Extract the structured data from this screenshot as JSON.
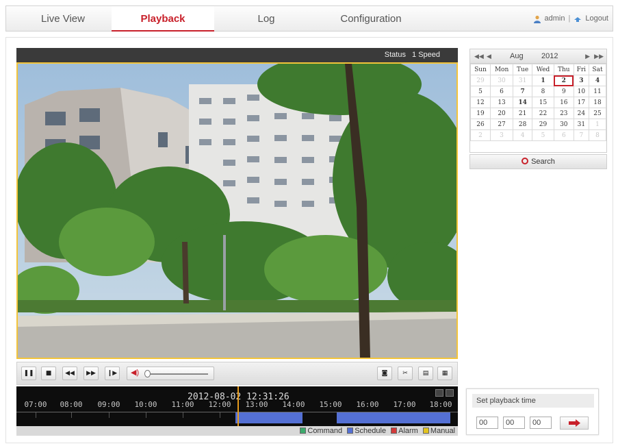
{
  "nav": {
    "tabs": [
      {
        "label": "Live View"
      },
      {
        "label": "Playback",
        "active": true
      },
      {
        "label": "Log"
      },
      {
        "label": "Configuration"
      }
    ],
    "user": "admin",
    "separator": "|",
    "logout": "Logout",
    "accent_color": "#c8202a"
  },
  "status": {
    "label": "Status",
    "speed": "1 Speed"
  },
  "toolbar": {
    "left_icons": [
      "pause-icon",
      "stop-icon",
      "slow-forward-icon",
      "fast-forward-icon",
      "single-frame-icon",
      "volume-icon"
    ],
    "right_icons": [
      "capture-icon",
      "clip-icon",
      "download-icon",
      "download-by-file-icon"
    ],
    "volume_level": 0.0
  },
  "timeline": {
    "current": "2012-08-02 12:31:26",
    "ticks": [
      "07:00",
      "08:00",
      "09:00",
      "10:00",
      "11:00",
      "12:00",
      "13:00",
      "14:00",
      "15:00",
      "16:00",
      "17:00",
      "18:00"
    ],
    "record_color": "#5470d4",
    "marker_color": "#e59a1b"
  },
  "legend": [
    {
      "label": "Command",
      "color": "#3daa6c"
    },
    {
      "label": "Schedule",
      "color": "#5470d4"
    },
    {
      "label": "Alarm",
      "color": "#d23a3a"
    },
    {
      "label": "Manual",
      "color": "#e2c320"
    }
  ],
  "calendar": {
    "prev_year": "◀◀",
    "prev_month": "◀",
    "month": "Aug",
    "year": "2012",
    "next_month": "▶",
    "next_year": "▶▶",
    "weekdays": [
      "Sun",
      "Mon",
      "Tue",
      "Wed",
      "Thu",
      "Fri",
      "Sat"
    ],
    "weeks": [
      [
        "29",
        "30",
        "31",
        "1",
        "2",
        "3",
        "4"
      ],
      [
        "5",
        "6",
        "7",
        "8",
        "9",
        "10",
        "11"
      ],
      [
        "12",
        "13",
        "14",
        "15",
        "16",
        "17",
        "18"
      ],
      [
        "19",
        "20",
        "21",
        "22",
        "23",
        "24",
        "25"
      ],
      [
        "26",
        "27",
        "28",
        "29",
        "30",
        "31",
        "1"
      ],
      [
        "2",
        "3",
        "4",
        "5",
        "6",
        "7",
        "8"
      ]
    ],
    "selected_day": "2"
  },
  "search": {
    "label": "Search"
  },
  "set_time": {
    "title": "Set playback time",
    "hour": "00",
    "minute": "00",
    "second": "00"
  }
}
